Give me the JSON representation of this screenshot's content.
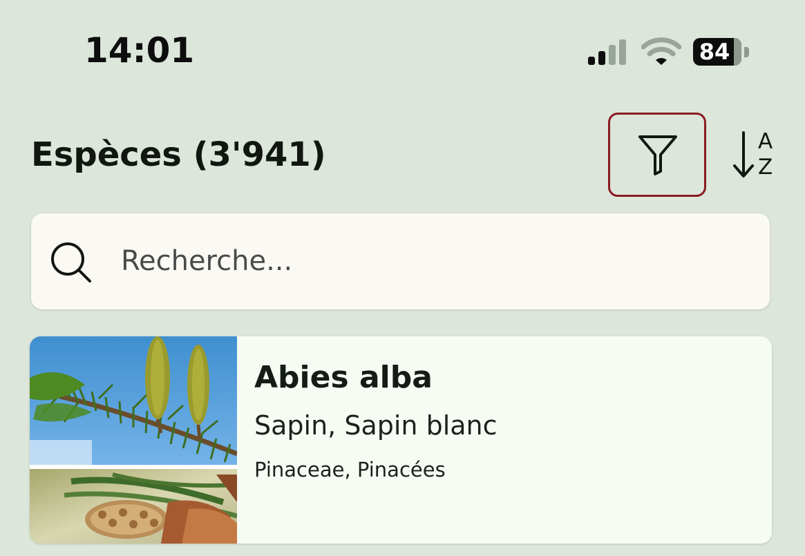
{
  "status_bar": {
    "time": "14:01",
    "battery_level": "84",
    "icons": [
      "signal-icon",
      "wifi-icon",
      "battery-icon"
    ]
  },
  "header": {
    "title": "Espèces (3'941)",
    "filter_icon": "filter-icon",
    "sort_icon": "sort-alpha-icon",
    "sort_letters": {
      "top": "A",
      "bottom": "Z"
    },
    "highlight_color": "#8b1a22"
  },
  "search": {
    "placeholder": "Recherche...",
    "value": "",
    "icon": "search-icon"
  },
  "species": [
    {
      "scientific_name": "Abies alba",
      "common_names": "Sapin, Sapin blanc",
      "family": "Pinaceae, Pinacées",
      "image": "fir-branch-photo"
    }
  ],
  "colors": {
    "background": "#dce6da",
    "card": "#f6fcf3",
    "search_bg": "#fbf9f3"
  }
}
